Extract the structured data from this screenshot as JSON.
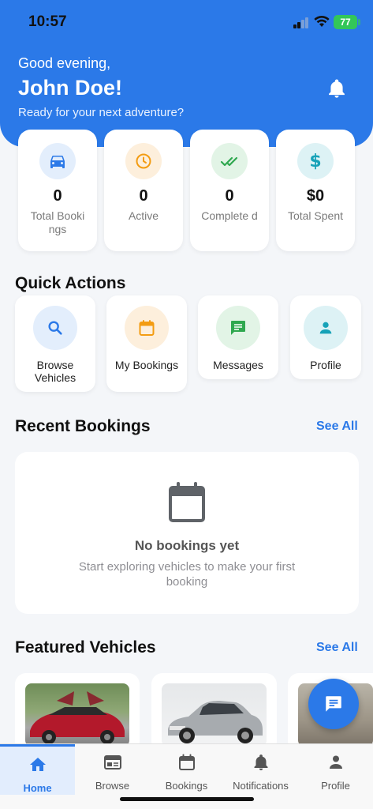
{
  "status_bar": {
    "time": "10:57",
    "battery": "77"
  },
  "header": {
    "greeting": "Good evening,",
    "user_name": "John Doe!",
    "tagline": "Ready for your next adventure?"
  },
  "stats": [
    {
      "value": "0",
      "label": "Total Bookings",
      "icon": "car-icon",
      "color": "#2b79e8",
      "bg": "#e3eefc"
    },
    {
      "value": "0",
      "label": "Active",
      "icon": "clock-icon",
      "color": "#f39c12",
      "bg": "#fdefdc"
    },
    {
      "value": "0",
      "label": "Complete d",
      "icon": "double-check-icon",
      "color": "#2fa84f",
      "bg": "#e2f4e6"
    },
    {
      "value": "$0",
      "label": "Total Spent",
      "icon": "dollar-icon",
      "color": "#17a2b8",
      "bg": "#ddf2f5"
    }
  ],
  "quick_actions": {
    "title": "Quick Actions",
    "items": [
      {
        "label": "Browse Vehicles",
        "icon": "search-icon",
        "color": "#2b79e8",
        "bg": "#e3eefc"
      },
      {
        "label": "My Bookings",
        "icon": "calendar-icon",
        "color": "#f39c12",
        "bg": "#fdefdc"
      },
      {
        "label": "Messages",
        "icon": "message-icon",
        "color": "#2fa84f",
        "bg": "#e2f4e6"
      },
      {
        "label": "Profile",
        "icon": "person-icon",
        "color": "#17a2b8",
        "bg": "#ddf2f5"
      }
    ]
  },
  "recent_bookings": {
    "title": "Recent Bookings",
    "see_all": "See All",
    "empty_title": "No bookings yet",
    "empty_subtitle": "Start exploring vehicles to make your first booking"
  },
  "featured_vehicles": {
    "title": "Featured Vehicles",
    "see_all": "See All",
    "vehicles": [
      {
        "photo": "red-suv-gullwing-photo"
      },
      {
        "photo": "silver-sedan-photo"
      },
      {
        "photo": "vehicle-photo-partial"
      }
    ]
  },
  "tabs": [
    {
      "label": "Home",
      "icon": "home-icon",
      "active": true
    },
    {
      "label": "Browse",
      "icon": "browse-icon",
      "active": false
    },
    {
      "label": "Bookings",
      "icon": "calendar-icon",
      "active": false
    },
    {
      "label": "Notifications",
      "icon": "bell-icon",
      "active": false
    },
    {
      "label": "Profile",
      "icon": "person-icon",
      "active": false
    }
  ],
  "colors": {
    "primary": "#2b79e8",
    "background": "#f4f6f9"
  }
}
